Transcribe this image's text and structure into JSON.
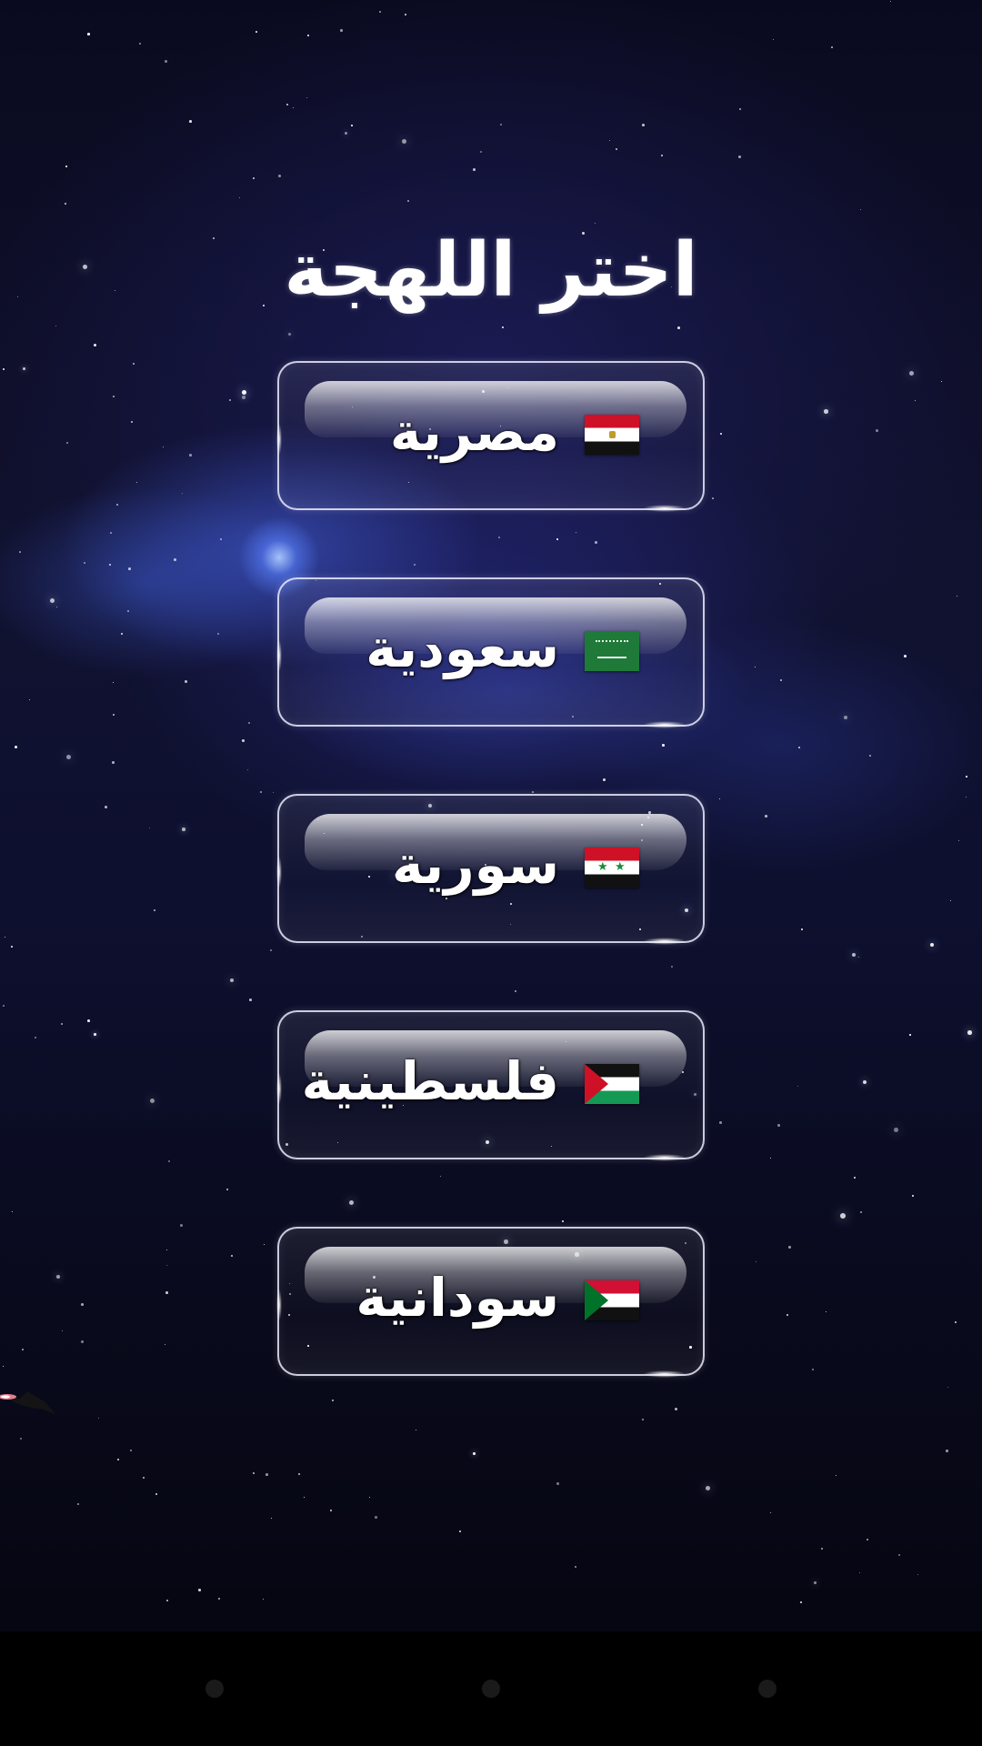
{
  "screen": {
    "title": "اختر اللهجة"
  },
  "dialects": [
    {
      "label": "مصرية",
      "flag": "egypt-flag-icon"
    },
    {
      "label": "سعودية",
      "flag": "saudi-flag-icon"
    },
    {
      "label": "سورية",
      "flag": "syria-flag-icon"
    },
    {
      "label": "فلسطينية",
      "flag": "palestine-flag-icon"
    },
    {
      "label": "سودانية",
      "flag": "sudan-flag-icon"
    }
  ],
  "navbar": {
    "buttons": [
      "back-button",
      "home-button",
      "recents-button"
    ]
  },
  "colors": {
    "background": "#0e1030",
    "text": "#ffffff",
    "button_border": "#ebebff",
    "navbar": "#000000"
  }
}
